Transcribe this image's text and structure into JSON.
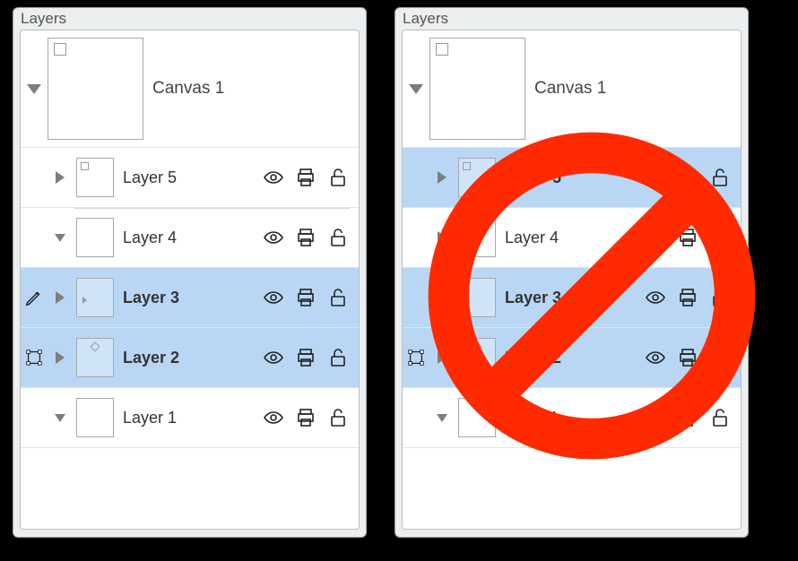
{
  "panels": [
    {
      "title": "Layers",
      "canvas": {
        "name": "Canvas 1",
        "expanded": true
      },
      "layers": [
        {
          "name": "Layer 5",
          "selected": false,
          "tool": "none",
          "triangle": "right",
          "thumbMark": "sq",
          "visible": true,
          "printable": true,
          "locked": false
        },
        {
          "name": "Layer 4",
          "selected": false,
          "tool": "none",
          "triangle": "down",
          "thumbMark": "",
          "visible": true,
          "printable": true,
          "locked": false
        },
        {
          "name": "Layer 3",
          "selected": true,
          "tool": "pencil",
          "triangle": "right",
          "thumbMark": "tri",
          "visible": true,
          "printable": true,
          "locked": false
        },
        {
          "name": "Layer 2",
          "selected": true,
          "tool": "bbox",
          "triangle": "right",
          "thumbMark": "dia",
          "visible": true,
          "printable": true,
          "locked": false
        },
        {
          "name": "Layer 1",
          "selected": false,
          "tool": "none",
          "triangle": "down",
          "thumbMark": "",
          "visible": true,
          "printable": true,
          "locked": false
        }
      ]
    },
    {
      "title": "Layers",
      "canvas": {
        "name": "Canvas 1",
        "expanded": true
      },
      "layers": [
        {
          "name": "Layer 5",
          "selected": true,
          "tool": "none",
          "triangle": "right",
          "thumbMark": "sq",
          "visible": true,
          "printable": true,
          "locked": false
        },
        {
          "name": "Layer 4",
          "selected": false,
          "tool": "none",
          "triangle": "right",
          "thumbMark": "",
          "visible": true,
          "printable": true,
          "locked": false
        },
        {
          "name": "Layer 3",
          "selected": true,
          "tool": "none",
          "triangle": "right",
          "thumbMark": "tri",
          "visible": true,
          "printable": true,
          "locked": false
        },
        {
          "name": "Layer 2",
          "selected": true,
          "tool": "bbox",
          "triangle": "right",
          "thumbMark": "dia",
          "visible": true,
          "printable": true,
          "locked": false
        },
        {
          "name": "Layer 1",
          "selected": false,
          "tool": "none",
          "triangle": "down",
          "thumbMark": "",
          "visible": true,
          "printable": true,
          "locked": false
        }
      ]
    }
  ],
  "overlay": {
    "prohibited_panel": 1,
    "color": "#ff2a00"
  }
}
